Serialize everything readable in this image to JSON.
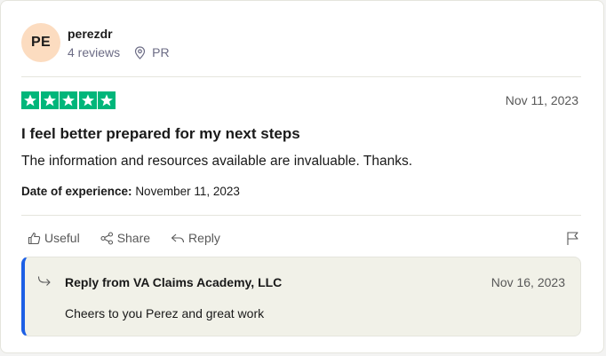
{
  "reviewer": {
    "initials": "PE",
    "name": "perezdr",
    "reviews_count": "4 reviews",
    "location": "PR",
    "avatar_color": "#fcdcc0"
  },
  "review": {
    "rating": 5,
    "rating_max": 5,
    "star_color": "#00b67a",
    "date": "Nov 11, 2023",
    "title": "I feel better prepared for my next steps",
    "text": "The information and resources available are invaluable. Thanks.",
    "experience_label": "Date of experience:",
    "experience_date": "November 11, 2023"
  },
  "actions": {
    "useful_label": "Useful",
    "share_label": "Share",
    "reply_label": "Reply",
    "icons": [
      "thumbs-up-icon",
      "share-icon",
      "reply-arrow-icon",
      "flag-icon"
    ]
  },
  "company_reply": {
    "from": "Reply from VA Claims Academy, LLC",
    "date": "Nov 16, 2023",
    "text": "Cheers to you Perez and great work",
    "accent_color": "#1c5fe5"
  }
}
